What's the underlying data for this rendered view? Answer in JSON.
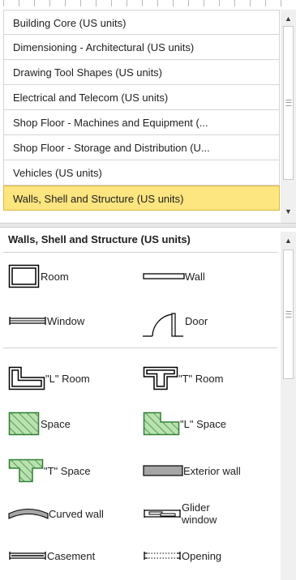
{
  "stencils": {
    "items": [
      {
        "label": "Building Core (US units)",
        "selected": false
      },
      {
        "label": "Dimensioning - Architectural (US units)",
        "selected": false
      },
      {
        "label": "Drawing Tool Shapes (US units)",
        "selected": false
      },
      {
        "label": "Electrical and Telecom (US units)",
        "selected": false
      },
      {
        "label": "Shop Floor - Machines and Equipment (...",
        "selected": false
      },
      {
        "label": "Shop Floor - Storage and Distribution (U...",
        "selected": false
      },
      {
        "label": "Vehicles (US units)",
        "selected": false
      },
      {
        "label": "Walls, Shell and Structure (US units)",
        "selected": true
      }
    ]
  },
  "shapes_panel": {
    "title": "Walls, Shell and Structure (US units)",
    "shapes": [
      {
        "label": "Room",
        "icon": "room-icon"
      },
      {
        "label": "Wall",
        "icon": "wall-icon"
      },
      {
        "label": "Window",
        "icon": "window-icon"
      },
      {
        "label": "Door",
        "icon": "door-icon"
      },
      {
        "label": "\"L\" Room",
        "icon": "l-room-icon"
      },
      {
        "label": "\"T\" Room",
        "icon": "t-room-icon"
      },
      {
        "label": "Space",
        "icon": "space-icon"
      },
      {
        "label": "\"L\" Space",
        "icon": "l-space-icon"
      },
      {
        "label": "\"T\" Space",
        "icon": "t-space-icon"
      },
      {
        "label": "Exterior wall",
        "icon": "exterior-wall-icon"
      },
      {
        "label": "Curved wall",
        "icon": "curved-wall-icon"
      },
      {
        "label": "Glider window",
        "icon": "glider-window-icon"
      },
      {
        "label": "Casement",
        "icon": "casement-icon"
      },
      {
        "label": "Opening",
        "icon": "opening-icon"
      }
    ]
  },
  "colors": {
    "selected_background": "#fde57f",
    "selected_border": "#e2b73b",
    "hatch_fill": "#b9e2b0",
    "hatch_stroke": "#2f7d33",
    "exterior_wall_fill": "#a6a6a6"
  }
}
